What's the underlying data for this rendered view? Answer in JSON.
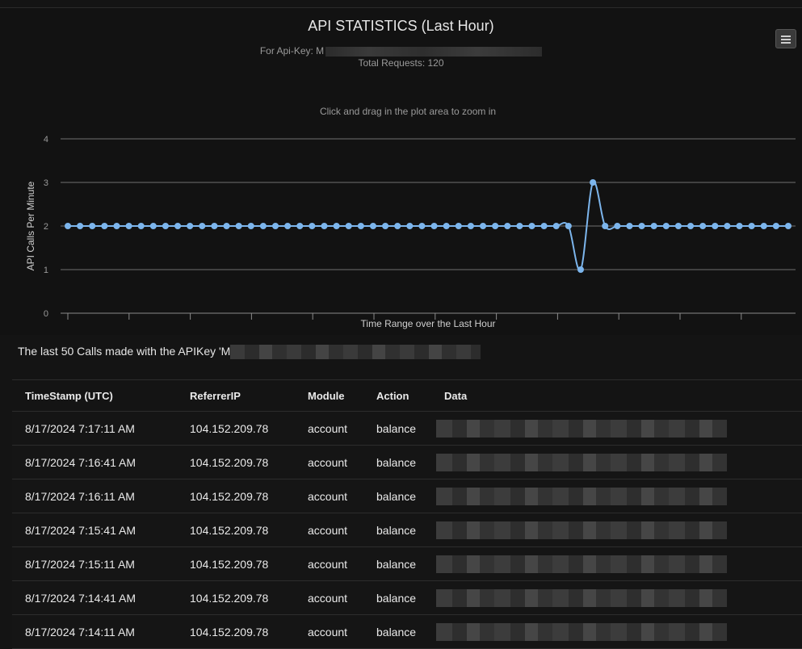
{
  "chart": {
    "title": "API STATISTICS (Last Hour)",
    "subtitle_prefix": "For Api-Key: M",
    "subtitle_requests": "Total Requests: 120",
    "zoom_hint": "Click and drag in the plot area to zoom in",
    "menu_icon": "hamburger-menu-icon"
  },
  "chart_data": {
    "type": "line",
    "title": "API STATISTICS (Last Hour)",
    "xlabel": "Time Range over the Last Hour",
    "ylabel": "API Calls Per Minute",
    "ylim": [
      0,
      4
    ],
    "yticks": [
      0,
      1,
      2,
      3,
      4
    ],
    "grid": true,
    "line_color": "#7cb5ec",
    "series": [
      {
        "values": [
          2,
          2,
          2,
          2,
          2,
          2,
          2,
          2,
          2,
          2,
          2,
          2,
          2,
          2,
          2,
          2,
          2,
          2,
          2,
          2,
          2,
          2,
          2,
          2,
          2,
          2,
          2,
          2,
          2,
          2,
          2,
          2,
          2,
          2,
          2,
          2,
          2,
          2,
          2,
          2,
          2,
          2,
          1,
          3,
          2,
          2,
          2,
          2,
          2,
          2,
          2,
          2,
          2,
          2,
          2,
          2,
          2,
          2,
          2,
          2
        ]
      }
    ]
  },
  "table": {
    "heading_prefix": "The last 50 Calls made with the APIKey 'M",
    "columns": [
      "TimeStamp (UTC)",
      "ReferrerIP",
      "Module",
      "Action",
      "Data"
    ],
    "rows": [
      {
        "timestamp": "8/17/2024 7:17:11 AM",
        "ip": "104.152.209.78",
        "module": "account",
        "action": "balance"
      },
      {
        "timestamp": "8/17/2024 7:16:41 AM",
        "ip": "104.152.209.78",
        "module": "account",
        "action": "balance"
      },
      {
        "timestamp": "8/17/2024 7:16:11 AM",
        "ip": "104.152.209.78",
        "module": "account",
        "action": "balance"
      },
      {
        "timestamp": "8/17/2024 7:15:41 AM",
        "ip": "104.152.209.78",
        "module": "account",
        "action": "balance"
      },
      {
        "timestamp": "8/17/2024 7:15:11 AM",
        "ip": "104.152.209.78",
        "module": "account",
        "action": "balance"
      },
      {
        "timestamp": "8/17/2024 7:14:41 AM",
        "ip": "104.152.209.78",
        "module": "account",
        "action": "balance"
      },
      {
        "timestamp": "8/17/2024 7:14:11 AM",
        "ip": "104.152.209.78",
        "module": "account",
        "action": "balance"
      }
    ]
  }
}
